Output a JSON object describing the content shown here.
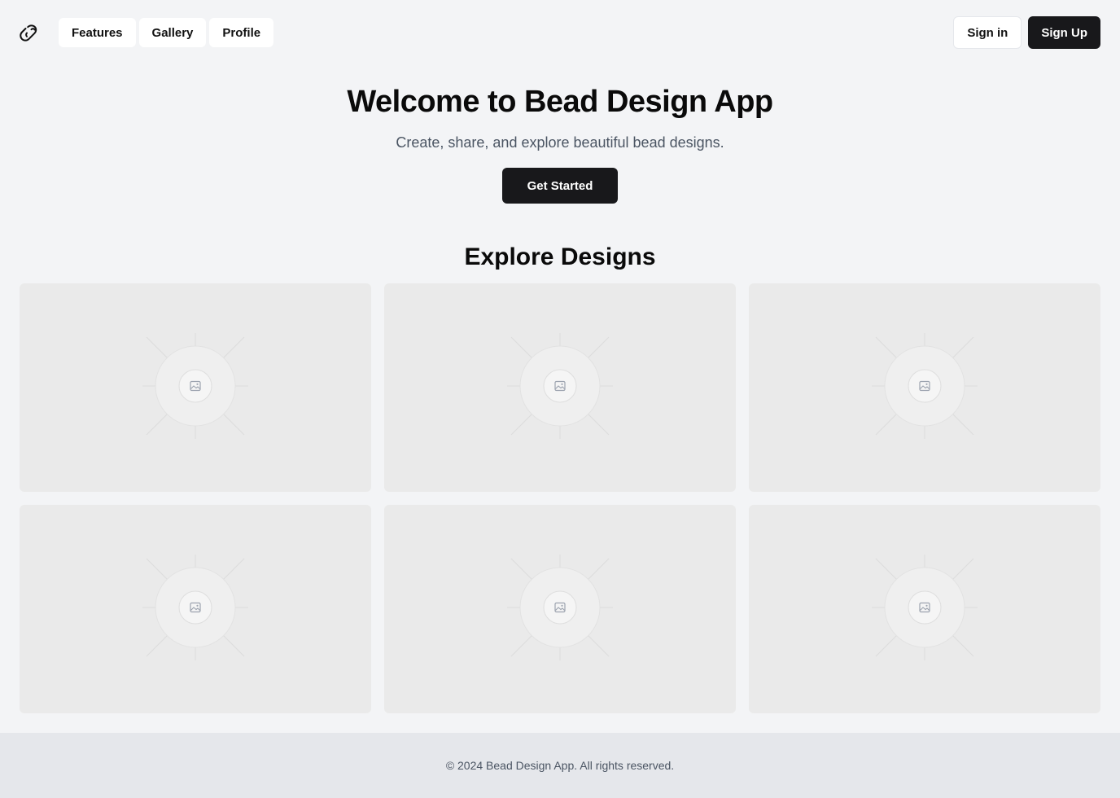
{
  "header": {
    "logo_icon": "bead-icon",
    "nav": [
      {
        "label": "Features"
      },
      {
        "label": "Gallery"
      },
      {
        "label": "Profile"
      }
    ],
    "signin_label": "Sign in",
    "signup_label": "Sign Up"
  },
  "hero": {
    "title": "Welcome to Bead Design App",
    "subtitle": "Create, share, and explore beautiful bead designs.",
    "cta_label": "Get Started"
  },
  "explore": {
    "title": "Explore Designs",
    "cards": [
      {
        "icon": "image-placeholder-icon"
      },
      {
        "icon": "image-placeholder-icon"
      },
      {
        "icon": "image-placeholder-icon"
      },
      {
        "icon": "image-placeholder-icon"
      },
      {
        "icon": "image-placeholder-icon"
      },
      {
        "icon": "image-placeholder-icon"
      }
    ]
  },
  "footer": {
    "text": "© 2024 Bead Design App. All rights reserved."
  },
  "colors": {
    "background": "#f3f4f6",
    "primary_button": "#18181b",
    "card_placeholder": "#eaeaea",
    "footer_background": "#e5e7eb"
  }
}
